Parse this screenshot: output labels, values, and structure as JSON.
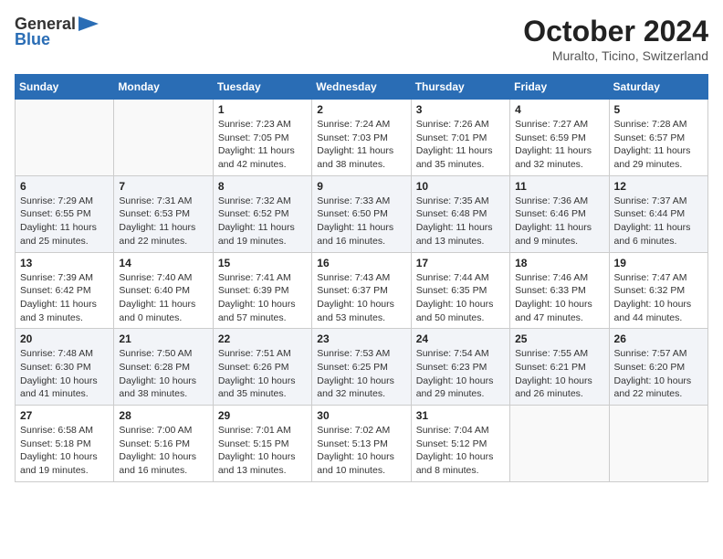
{
  "logo": {
    "general": "General",
    "blue": "Blue"
  },
  "title": "October 2024",
  "location": "Muralto, Ticino, Switzerland",
  "days_of_week": [
    "Sunday",
    "Monday",
    "Tuesday",
    "Wednesday",
    "Thursday",
    "Friday",
    "Saturday"
  ],
  "weeks": [
    [
      {
        "day": "",
        "info": ""
      },
      {
        "day": "",
        "info": ""
      },
      {
        "day": "1",
        "info": "Sunrise: 7:23 AM\nSunset: 7:05 PM\nDaylight: 11 hours\nand 42 minutes."
      },
      {
        "day": "2",
        "info": "Sunrise: 7:24 AM\nSunset: 7:03 PM\nDaylight: 11 hours\nand 38 minutes."
      },
      {
        "day": "3",
        "info": "Sunrise: 7:26 AM\nSunset: 7:01 PM\nDaylight: 11 hours\nand 35 minutes."
      },
      {
        "day": "4",
        "info": "Sunrise: 7:27 AM\nSunset: 6:59 PM\nDaylight: 11 hours\nand 32 minutes."
      },
      {
        "day": "5",
        "info": "Sunrise: 7:28 AM\nSunset: 6:57 PM\nDaylight: 11 hours\nand 29 minutes."
      }
    ],
    [
      {
        "day": "6",
        "info": "Sunrise: 7:29 AM\nSunset: 6:55 PM\nDaylight: 11 hours\nand 25 minutes."
      },
      {
        "day": "7",
        "info": "Sunrise: 7:31 AM\nSunset: 6:53 PM\nDaylight: 11 hours\nand 22 minutes."
      },
      {
        "day": "8",
        "info": "Sunrise: 7:32 AM\nSunset: 6:52 PM\nDaylight: 11 hours\nand 19 minutes."
      },
      {
        "day": "9",
        "info": "Sunrise: 7:33 AM\nSunset: 6:50 PM\nDaylight: 11 hours\nand 16 minutes."
      },
      {
        "day": "10",
        "info": "Sunrise: 7:35 AM\nSunset: 6:48 PM\nDaylight: 11 hours\nand 13 minutes."
      },
      {
        "day": "11",
        "info": "Sunrise: 7:36 AM\nSunset: 6:46 PM\nDaylight: 11 hours\nand 9 minutes."
      },
      {
        "day": "12",
        "info": "Sunrise: 7:37 AM\nSunset: 6:44 PM\nDaylight: 11 hours\nand 6 minutes."
      }
    ],
    [
      {
        "day": "13",
        "info": "Sunrise: 7:39 AM\nSunset: 6:42 PM\nDaylight: 11 hours\nand 3 minutes."
      },
      {
        "day": "14",
        "info": "Sunrise: 7:40 AM\nSunset: 6:40 PM\nDaylight: 11 hours\nand 0 minutes."
      },
      {
        "day": "15",
        "info": "Sunrise: 7:41 AM\nSunset: 6:39 PM\nDaylight: 10 hours\nand 57 minutes."
      },
      {
        "day": "16",
        "info": "Sunrise: 7:43 AM\nSunset: 6:37 PM\nDaylight: 10 hours\nand 53 minutes."
      },
      {
        "day": "17",
        "info": "Sunrise: 7:44 AM\nSunset: 6:35 PM\nDaylight: 10 hours\nand 50 minutes."
      },
      {
        "day": "18",
        "info": "Sunrise: 7:46 AM\nSunset: 6:33 PM\nDaylight: 10 hours\nand 47 minutes."
      },
      {
        "day": "19",
        "info": "Sunrise: 7:47 AM\nSunset: 6:32 PM\nDaylight: 10 hours\nand 44 minutes."
      }
    ],
    [
      {
        "day": "20",
        "info": "Sunrise: 7:48 AM\nSunset: 6:30 PM\nDaylight: 10 hours\nand 41 minutes."
      },
      {
        "day": "21",
        "info": "Sunrise: 7:50 AM\nSunset: 6:28 PM\nDaylight: 10 hours\nand 38 minutes."
      },
      {
        "day": "22",
        "info": "Sunrise: 7:51 AM\nSunset: 6:26 PM\nDaylight: 10 hours\nand 35 minutes."
      },
      {
        "day": "23",
        "info": "Sunrise: 7:53 AM\nSunset: 6:25 PM\nDaylight: 10 hours\nand 32 minutes."
      },
      {
        "day": "24",
        "info": "Sunrise: 7:54 AM\nSunset: 6:23 PM\nDaylight: 10 hours\nand 29 minutes."
      },
      {
        "day": "25",
        "info": "Sunrise: 7:55 AM\nSunset: 6:21 PM\nDaylight: 10 hours\nand 26 minutes."
      },
      {
        "day": "26",
        "info": "Sunrise: 7:57 AM\nSunset: 6:20 PM\nDaylight: 10 hours\nand 22 minutes."
      }
    ],
    [
      {
        "day": "27",
        "info": "Sunrise: 6:58 AM\nSunset: 5:18 PM\nDaylight: 10 hours\nand 19 minutes."
      },
      {
        "day": "28",
        "info": "Sunrise: 7:00 AM\nSunset: 5:16 PM\nDaylight: 10 hours\nand 16 minutes."
      },
      {
        "day": "29",
        "info": "Sunrise: 7:01 AM\nSunset: 5:15 PM\nDaylight: 10 hours\nand 13 minutes."
      },
      {
        "day": "30",
        "info": "Sunrise: 7:02 AM\nSunset: 5:13 PM\nDaylight: 10 hours\nand 10 minutes."
      },
      {
        "day": "31",
        "info": "Sunrise: 7:04 AM\nSunset: 5:12 PM\nDaylight: 10 hours\nand 8 minutes."
      },
      {
        "day": "",
        "info": ""
      },
      {
        "day": "",
        "info": ""
      }
    ]
  ]
}
